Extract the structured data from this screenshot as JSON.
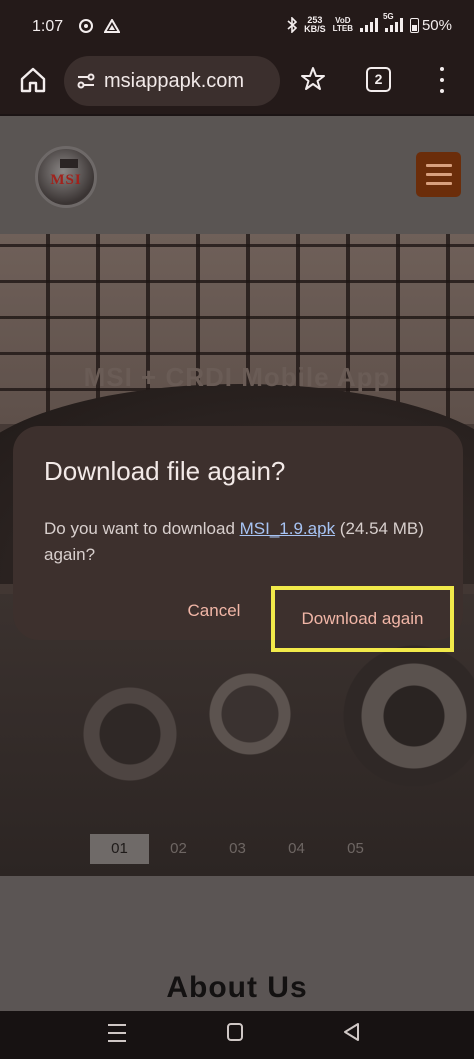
{
  "status_bar": {
    "time": "1:07",
    "net_speed_value": "253",
    "net_speed_unit": "KB/S",
    "volte_top": "VoD",
    "volte_bottom": "LTEB",
    "network": "5G",
    "battery": "50%"
  },
  "browser": {
    "url": "msiappapk.com",
    "tab_count": "2"
  },
  "site": {
    "logo_text": "MSI",
    "hero_title": "MSI + CRDI Mobile App",
    "slides": [
      {
        "label": "01",
        "active": true
      },
      {
        "label": "02",
        "active": false
      },
      {
        "label": "03",
        "active": false
      },
      {
        "label": "04",
        "active": false
      },
      {
        "label": "05",
        "active": false
      }
    ],
    "about_heading": "About Us"
  },
  "dialog": {
    "title": "Download file again?",
    "body_prefix": "Do you want to download ",
    "file_name": "MSI_1.9.apk",
    "body_suffix": " (24.54 MB) again?",
    "cancel_label": "Cancel",
    "download_label": "Download again",
    "highlight_color": "#f1ea4a"
  }
}
